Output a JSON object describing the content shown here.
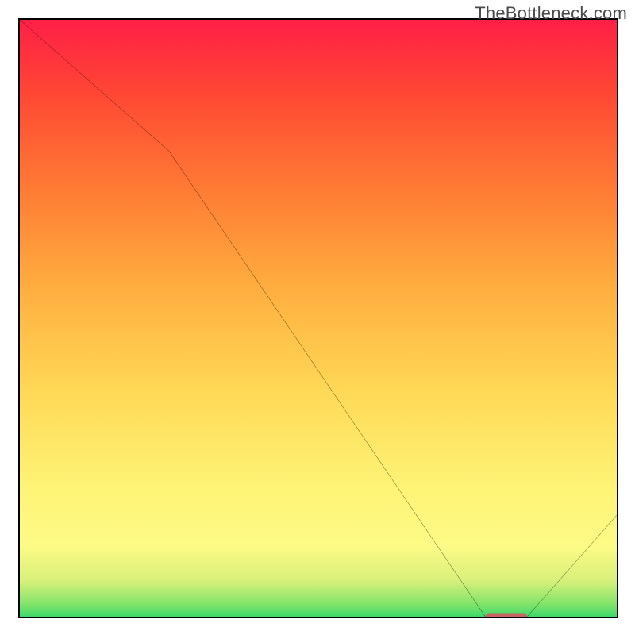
{
  "watermark": "TheBottleneck.com",
  "chart_data": {
    "type": "line",
    "title": "",
    "xlabel": "",
    "ylabel": "",
    "xlim": [
      0,
      100
    ],
    "ylim": [
      0,
      100
    ],
    "series": [
      {
        "name": "curve",
        "x": [
          0,
          25,
          78,
          85,
          100
        ],
        "y": [
          100,
          78,
          0,
          0,
          17
        ]
      }
    ],
    "flat_segment": {
      "x0": 78,
      "x1": 85,
      "y": 0
    },
    "gradient_stops": [
      {
        "pct": 0,
        "color": "#3dd96a"
      },
      {
        "pct": 2,
        "color": "#7fe36a"
      },
      {
        "pct": 6,
        "color": "#d7f07a"
      },
      {
        "pct": 12,
        "color": "#fdfb86"
      },
      {
        "pct": 22,
        "color": "#fef375"
      },
      {
        "pct": 38,
        "color": "#ffd856"
      },
      {
        "pct": 55,
        "color": "#ffae3f"
      },
      {
        "pct": 72,
        "color": "#ff7a34"
      },
      {
        "pct": 88,
        "color": "#ff4634"
      },
      {
        "pct": 100,
        "color": "#ff1f47"
      }
    ],
    "marker_color": "#c96661"
  }
}
